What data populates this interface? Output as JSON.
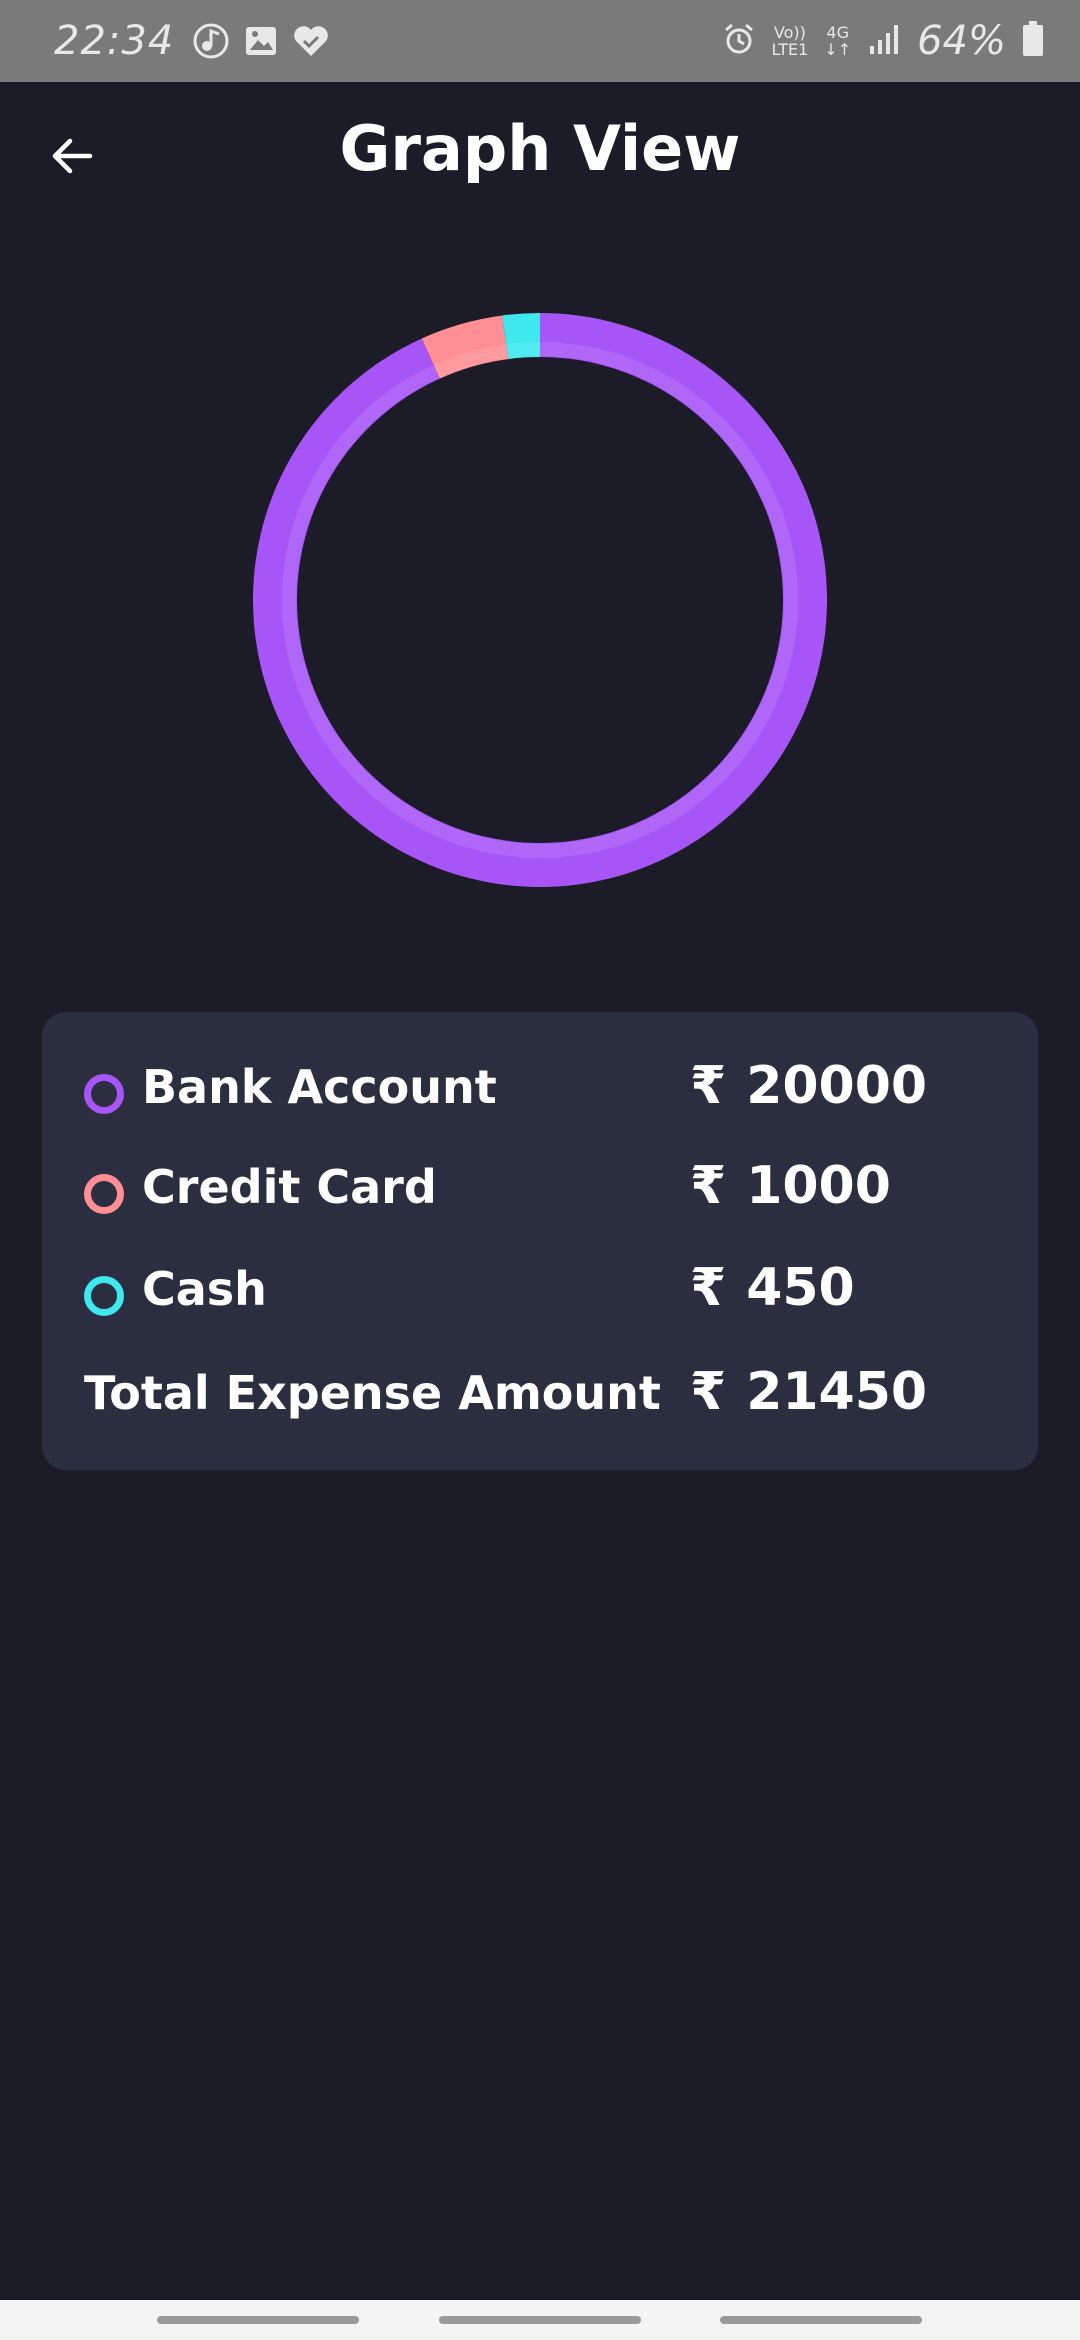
{
  "status_bar": {
    "time": "22:34",
    "left_icons": [
      "music-note-icon",
      "image-icon",
      "heart-check-icon"
    ],
    "right_icons": [
      "alarm-icon",
      "volte-icon",
      "data-arrows-icon",
      "signal-icon",
      "battery-icon"
    ],
    "volte_top": "Vo))",
    "volte_bottom": "LTE1",
    "network": "4G",
    "battery": "64%"
  },
  "header": {
    "title": "Graph View",
    "back_icon": "arrow-left-icon"
  },
  "chart_data": {
    "type": "pie",
    "style": "donut",
    "categories": [
      "Bank Account",
      "Credit Card",
      "Cash"
    ],
    "values": [
      20000,
      1000,
      450
    ],
    "colors": [
      "#a855f7",
      "#ff8f94",
      "#3ee8ec"
    ],
    "total": 21450
  },
  "summary": {
    "currency_symbol": "₹",
    "rows": [
      {
        "label": "Bank Account",
        "amount": "20000",
        "color": "#a855f7"
      },
      {
        "label": "Credit Card",
        "amount": "1000",
        "color": "#ff8f94"
      },
      {
        "label": "Cash",
        "amount": "450",
        "color": "#3ee8ec"
      }
    ],
    "total_label": "Total Expense Amount",
    "total_amount": "21450"
  }
}
